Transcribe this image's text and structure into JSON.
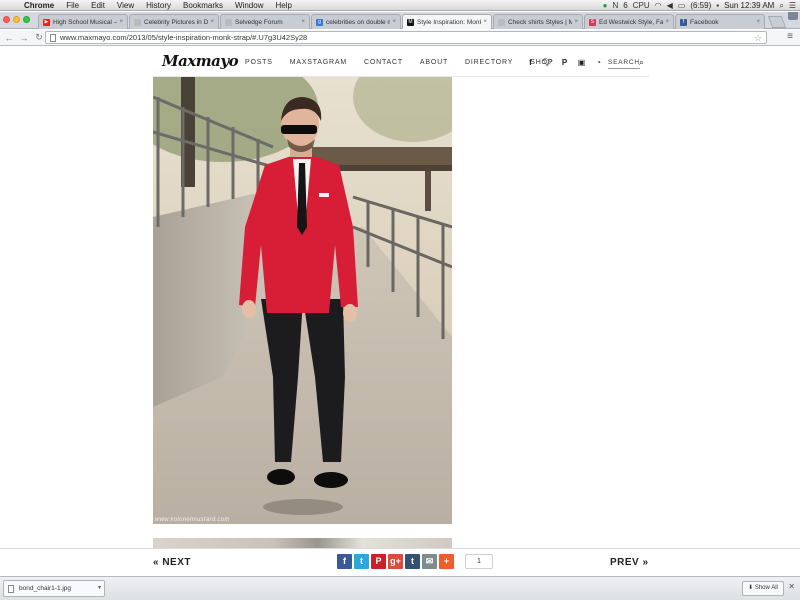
{
  "menubar": {
    "app_name": "Chrome",
    "items": [
      "File",
      "Edit",
      "View",
      "History",
      "Bookmarks",
      "Window",
      "Help"
    ],
    "status": {
      "notification_count": "6",
      "battery": "(6:59)",
      "clock": "Sun 12:39 AM",
      "cpu_label": "CPU"
    }
  },
  "tabs": [
    {
      "title": "High School Musical – C",
      "favicon_color": "#e62117",
      "favicon_glyph": "▶"
    },
    {
      "title": "Celebrity Pictures in De",
      "favicon_color": "#bbbbbb",
      "favicon_glyph": ""
    },
    {
      "title": "Selvedge Forum",
      "favicon_color": "#bbbbbb",
      "favicon_glyph": ""
    },
    {
      "title": "celebrities on double m",
      "favicon_color": "#3b77d6",
      "favicon_glyph": "g"
    },
    {
      "title": "Style Inspiration: Monk",
      "favicon_color": "#111111",
      "favicon_glyph": "M",
      "active": true
    },
    {
      "title": "Check shirts Styles | M",
      "favicon_color": "#bbbbbb",
      "favicon_glyph": ""
    },
    {
      "title": "Ed Westwick Style, Fash",
      "favicon_color": "#d4395b",
      "favicon_glyph": "S"
    },
    {
      "title": "Facebook",
      "favicon_color": "#3b5998",
      "favicon_glyph": "f"
    }
  ],
  "toolbar": {
    "url": "www.maxmayo.com/2013/05/style-inspiration-monk-strap/#.U7g3U42Sy28"
  },
  "site": {
    "logo": "Maxmayo",
    "nav": [
      "POSTS",
      "MAXSTAGRAM",
      "CONTACT",
      "ABOUT",
      "DIRECTORY",
      "SHOP"
    ],
    "social_icons": [
      "facebook-icon",
      "twitter-icon",
      "pinterest-icon",
      "instagram-icon",
      "rss-icon"
    ],
    "search_label": "SEARCH",
    "hero_credit": "www.kolonelmustard.com"
  },
  "sharebar": {
    "next_label": "« NEXT",
    "prev_label": "PREV »",
    "share_count": "1",
    "buttons": [
      {
        "name": "facebook-share-button",
        "glyph": "f",
        "color": "#3b5998"
      },
      {
        "name": "twitter-share-button",
        "glyph": "t",
        "color": "#2ca7e0"
      },
      {
        "name": "pinterest-share-button",
        "glyph": "P",
        "color": "#cb2027"
      },
      {
        "name": "googleplus-share-button",
        "glyph": "g+",
        "color": "#dd4b39"
      },
      {
        "name": "tumblr-share-button",
        "glyph": "t",
        "color": "#34526f"
      },
      {
        "name": "email-share-button",
        "glyph": "✉",
        "color": "#7f8c8d"
      },
      {
        "name": "more-share-button",
        "glyph": "+",
        "color": "#f05d2b"
      }
    ]
  },
  "downloads": {
    "file_name": "bond_chair1-1.jpg",
    "show_all_label": "Show All"
  }
}
